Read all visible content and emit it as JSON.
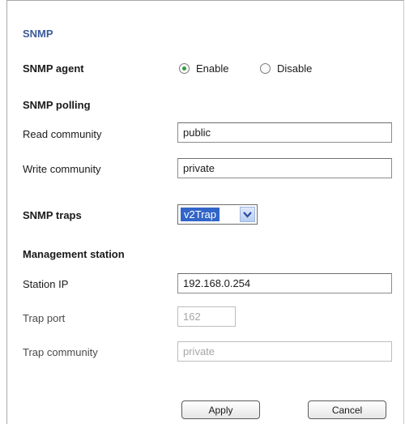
{
  "title": "SNMP",
  "agent": {
    "label": "SNMP agent",
    "enable_label": "Enable",
    "disable_label": "Disable",
    "selected": "Enable"
  },
  "polling": {
    "heading": "SNMP polling",
    "read_label": "Read community",
    "read_value": "public",
    "write_label": "Write community",
    "write_value": "private"
  },
  "traps": {
    "label": "SNMP traps",
    "selected": "v2Trap"
  },
  "management": {
    "heading": "Management station",
    "station_ip_label": "Station IP",
    "station_ip_value": "192.168.0.254",
    "trap_port_label": "Trap port",
    "trap_port_value": "162",
    "trap_community_label": "Trap community",
    "trap_community_value": "private"
  },
  "buttons": {
    "apply": "Apply",
    "cancel": "Cancel"
  },
  "colors": {
    "title": "#3c5a9a",
    "select_highlight": "#3265c8",
    "radio_checked": "#2e9e3e"
  }
}
